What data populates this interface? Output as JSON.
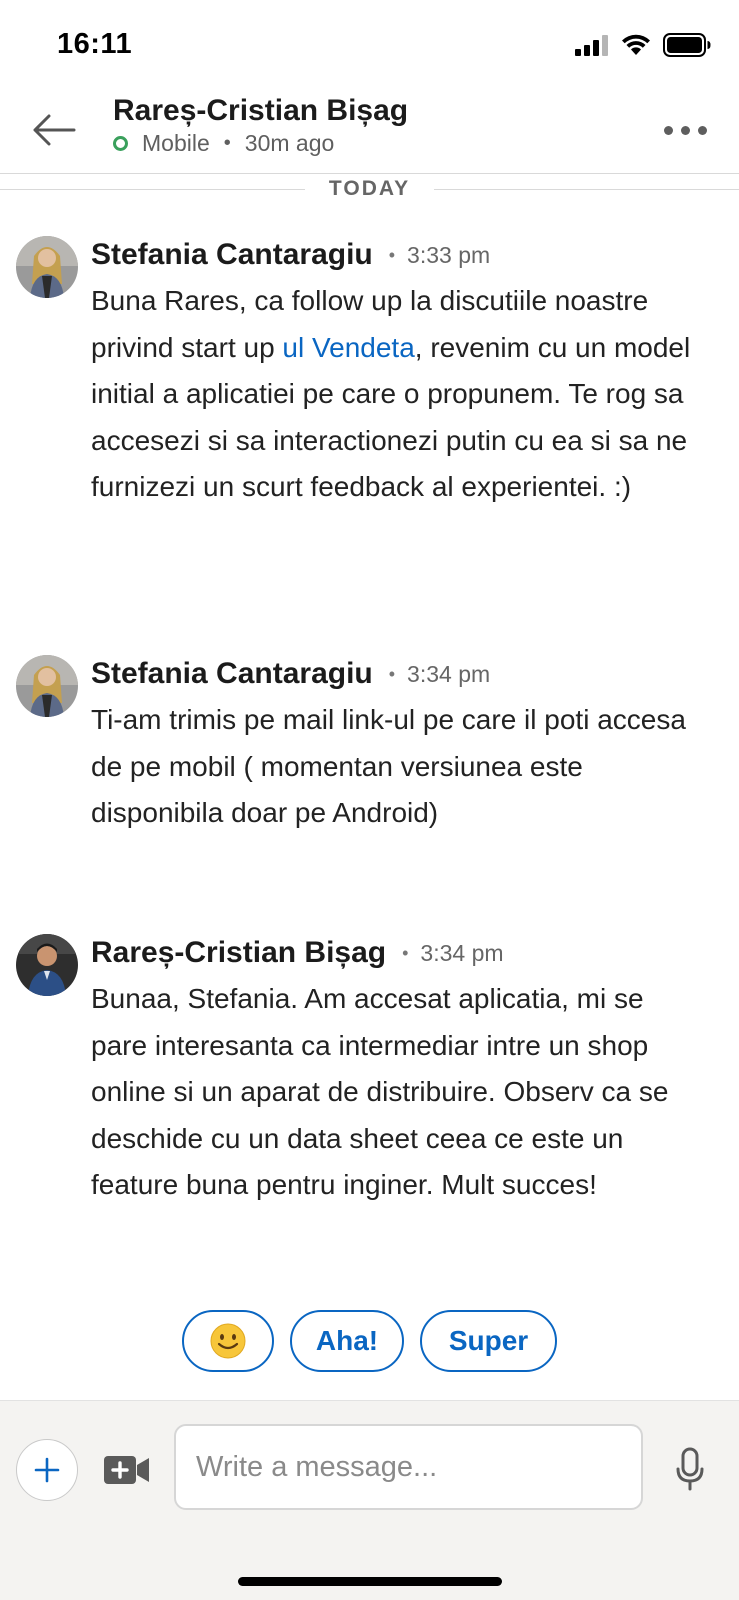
{
  "status_bar": {
    "time": "16:11"
  },
  "header": {
    "contact_name": "Rareș-Cristian Bișag",
    "presence_status": "Mobile",
    "last_seen": "30m ago"
  },
  "date_divider": "TODAY",
  "messages": [
    {
      "sender": "Stefania Cantaragiu",
      "time": "3:33 pm",
      "text_before_link": "Buna Rares, ca follow up la discutiile noastre privind start up ",
      "link_text": "ul Vendeta",
      "text_after_link": ", revenim cu un model initial a aplicatiei pe care o propunem. Te rog sa accesezi si sa interactionezi putin cu ea si sa ne furnizezi un scurt feedback al experientei. :)"
    },
    {
      "sender": "Stefania Cantaragiu",
      "time": "3:34 pm",
      "text": "Ti-am trimis pe mail link-ul pe care il poti accesa de pe mobil ( momentan versiunea este disponibila doar pe Android)"
    },
    {
      "sender": "Rareș-Cristian Bișag",
      "time": "3:34 pm",
      "text": "Bunaa, Stefania. Am accesat aplicatia, mi se pare interesanta ca intermediar intre un shop online si un aparat de distribuire. Observ ca se deschide cu un data sheet ceea ce este un feature buna pentru inginer. Mult succes!"
    }
  ],
  "quick_replies": {
    "emoji": "🙂",
    "aha": "Aha!",
    "super": "Super"
  },
  "composer": {
    "placeholder": "Write a message...",
    "value": ""
  },
  "colors": {
    "accent": "#0a66c2",
    "online": "#3aa05c"
  },
  "icons": [
    "back-arrow-icon",
    "more-options-icon",
    "plus-icon",
    "video-camera-icon",
    "microphone-icon",
    "signal-icon",
    "wifi-icon",
    "battery-icon"
  ]
}
